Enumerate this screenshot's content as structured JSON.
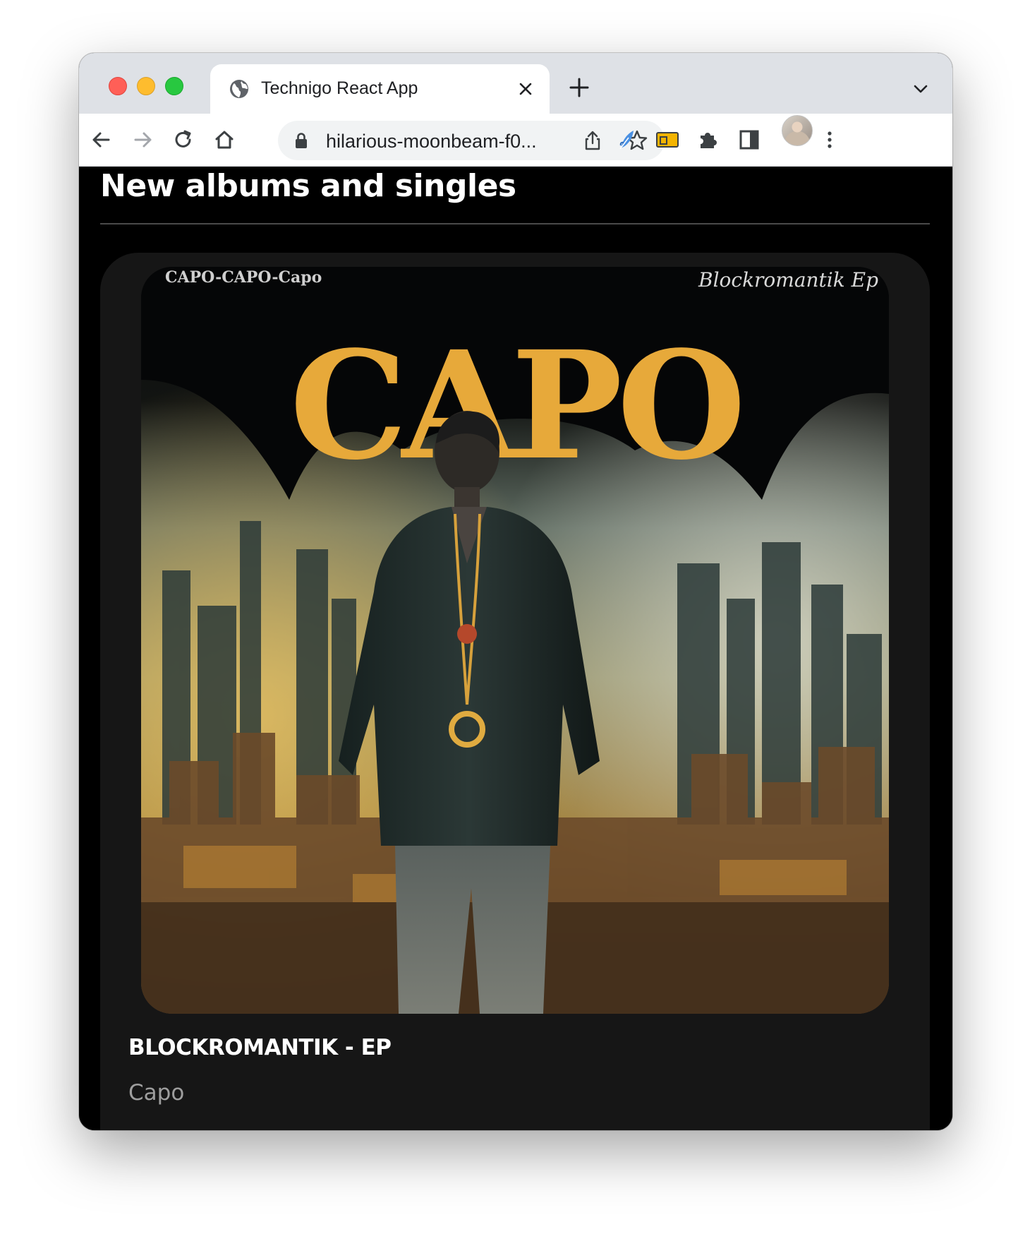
{
  "browser": {
    "tab_title": "Technigo React App",
    "url": "hilarious-moonbeam-f0..."
  },
  "page": {
    "section_title": "New albums and singles",
    "albums": [
      {
        "title": "BLOCKROMANTIK - EP",
        "artist": "Capo",
        "cover_art_text": {
          "top_left": "CAPO-CAPO-Capo",
          "top_right": "Blockromantik Ep",
          "logo": "CAPO"
        }
      }
    ]
  },
  "colors": {
    "page_background": "#000000",
    "card_background": "#161616",
    "artist_text": "#9e9e9e",
    "logo_gold": "#e7a93a"
  }
}
